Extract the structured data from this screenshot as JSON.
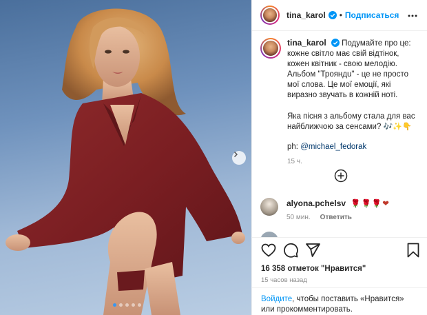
{
  "post": {
    "username": "tina_karol",
    "follow_label": "Подписаться",
    "separator": "•",
    "caption": {
      "text": "Подумайте про це: кожне світло має свій відтінок, кожен квітник - свою мелодію. Альбом \"Трояндu\" - це не просто мої слова. Це мої емоції, які виразно звучать в кожній ноті.",
      "question": "Яка пісня з альбому стала для вас найближчою за сенсами?",
      "question_emojis": "🎶✨👇",
      "credit_prefix": "ph: ",
      "credit_mention": "@michael_fedorak",
      "time": "15 ч."
    },
    "comments": [
      {
        "username": "alyona.pchelsv",
        "text": "🌹🌹🌹❤",
        "time": "50 мин.",
        "reply_label": "Ответить"
      }
    ],
    "likes": "16 358 отметок \"Нравится\"",
    "posted_ago": "15 часов назад",
    "login_prompt": {
      "link": "Войдите",
      "text": ", чтобы поставить «Нравится» или прокомментировать."
    },
    "carousel": {
      "slide_count": 5,
      "active_index": 0
    }
  },
  "icons": {
    "verified": "verified-badge-icon",
    "more": "more-options-icon",
    "load_more": "plus-circle-icon",
    "like": "heart-icon",
    "comment": "comment-icon",
    "share": "paper-plane-icon",
    "save": "bookmark-icon",
    "next": "chevron-right-icon"
  },
  "colors": {
    "accent": "#0095f6",
    "verified": "#0095f6",
    "text": "#262626",
    "muted": "#8e8e8e",
    "jacket": "#7d1f22"
  }
}
